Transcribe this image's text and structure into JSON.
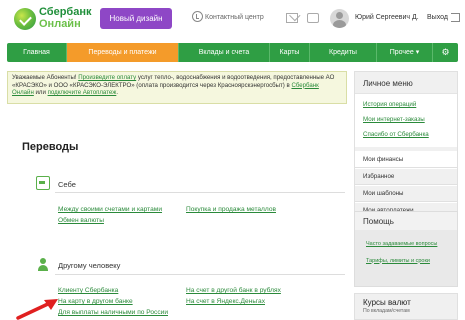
{
  "header": {
    "logo_line1": "Сбербанк",
    "logo_line2": "Онлайн",
    "new_design": "Новый дизайн",
    "contact_center": "Контактный центр",
    "user_name": "Юрий Сергеевич Д.",
    "exit": "Выход"
  },
  "nav": {
    "items": [
      {
        "label": "Главная",
        "active": false
      },
      {
        "label": "Переводы и платежи",
        "active": true
      },
      {
        "label": "Вклады и счета",
        "active": false
      },
      {
        "label": "Карты",
        "active": false
      },
      {
        "label": "Кредиты",
        "active": false
      },
      {
        "label": "Прочее ▾",
        "active": false
      }
    ],
    "settings_icon": "gear-icon"
  },
  "notice": {
    "p1": "Уважаемые Абоненты! ",
    "link1": "Произведите оплату",
    "p2": " услуг тепло-, водоснабжения и водоотведения, предоставленные АО «КРАСЭКО» и ООО «КРАСЭКО-ЭЛЕКТРО» (оплата производится через Красноярскэнергосбыт) в ",
    "link2": "Сбербанк Онлайн",
    "p3": " или ",
    "link3": "подключите Автоплатеж",
    "p4": "."
  },
  "main": {
    "title": "Переводы",
    "self": {
      "title": "Себе",
      "links": [
        "Между своими счетами и картами",
        "Обмен валюты",
        "Покупка и продажа металлов"
      ]
    },
    "other": {
      "title": "Другому человеку",
      "links": [
        "Клиенту Сбербанка",
        "На карту в другом банке",
        "Для выплаты наличными по России",
        "На счет в другой банк в рублях",
        "На счет в Яндекс.Деньгах"
      ]
    }
  },
  "sidebar": {
    "menu_title": "Личное меню",
    "links": [
      "История операций",
      "Мои интернет-заказы",
      "Спасибо от Сбербанка"
    ],
    "plain": [
      "Мои финансы",
      "Избранное",
      "Мои шаблоны",
      "Мои автоплатежи"
    ],
    "help_title": "Помощь",
    "help_links": [
      "Часто задаваемые вопросы",
      "Тарифы, лимиты и сроки"
    ],
    "rates_title": "Курсы валют",
    "rates_sub": "По вкладам/счетам"
  },
  "colors": {
    "brand_green": "#2f9e44",
    "active_tab": "#f49b2a",
    "new_design_button": "#8e47c6",
    "arrow": "#e02020"
  }
}
